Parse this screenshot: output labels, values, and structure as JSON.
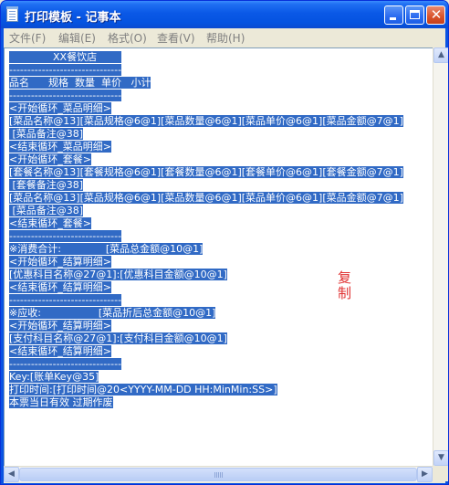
{
  "window": {
    "title": "打印模板 - 记事本"
  },
  "menu": [
    {
      "label": "文件(F)"
    },
    {
      "label": "编辑(E)"
    },
    {
      "label": "格式(O)"
    },
    {
      "label": "查看(V)"
    },
    {
      "label": "帮助(H)"
    }
  ],
  "editor": {
    "lines": [
      "XX餐饮店",
      "-------------------------------",
      "品名      规格  数量  单价   小计",
      "-------------------------------",
      "<开始循环_菜品明细>",
      "[菜品名称@13][菜品规格@6@1][菜品数量@6@1][菜品单价@6@1][菜品金额@7@1]",
      " [菜品备注@38]",
      "<结束循环_菜品明细>",
      "<开始循环_套餐>",
      "[套餐名称@13][套餐规格@6@1][套餐数量@6@1][套餐单价@6@1][套餐金额@7@1]",
      " [套餐备注@38]",
      "[菜品名称@13][菜品规格@6@1][菜品数量@6@1][菜品单价@6@1][菜品金额@7@1]",
      " [菜品备注@38]",
      "<结束循环_套餐>",
      "-------------------------------",
      "※消费合计:              [菜品总金额@10@1]",
      "<开始循环_结算明细>",
      "[优惠科目名称@27@1]:[优惠科目金额@10@1]",
      "<结束循环_结算明细>",
      "-------------------------------",
      "※应收:                  [菜品折后总金额@10@1]",
      "<开始循环_结算明细>",
      "[支付科目名称@27@1]:[支付科目金额@10@1]",
      "<结束循环_结算明细>",
      "-------------------------------",
      "Key:[账单Key@35]",
      "打印时间:[打印时间@20<YYYY-MM-DD HH:MinMin:SS>]",
      "本票当日有效 过期作废"
    ],
    "overlay_text": "复制"
  },
  "colors": {
    "selection": "#316ac5",
    "title_bar": "#0a58e6",
    "overlay": "#e03030"
  }
}
